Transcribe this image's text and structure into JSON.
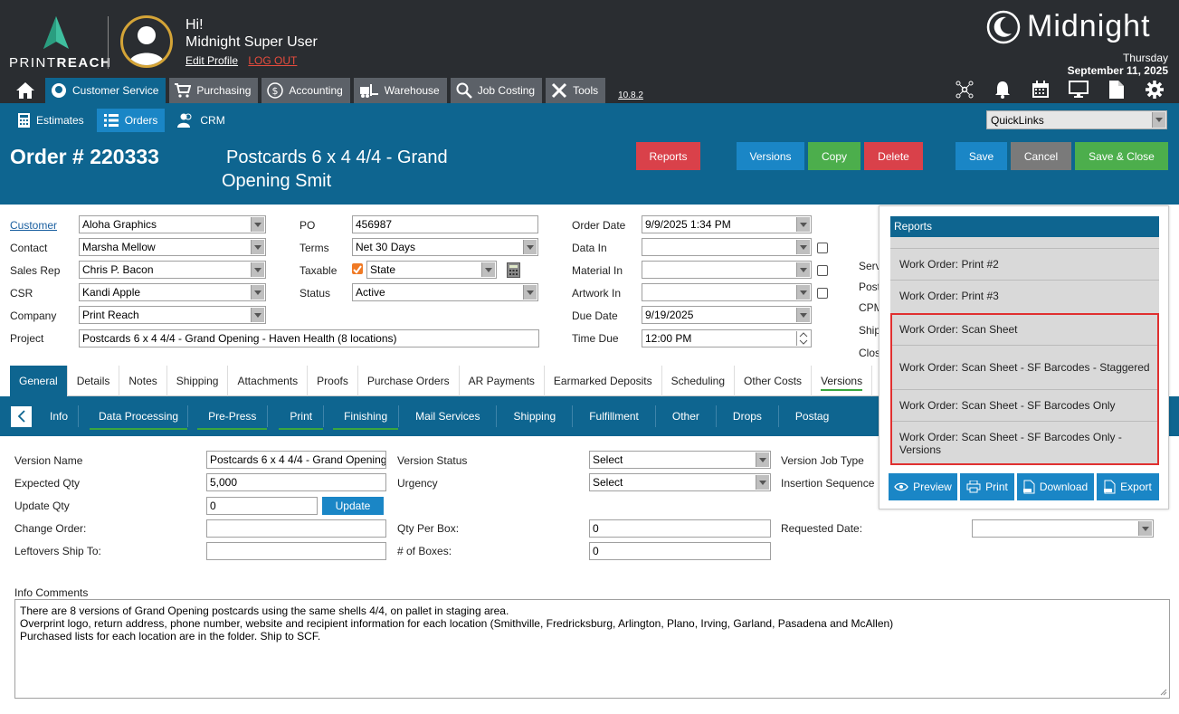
{
  "header": {
    "logo_text_a": "PRINT",
    "logo_text_b": "REACH",
    "greeting": "Hi!",
    "user_name": "Midnight Super User",
    "edit_profile": "Edit Profile",
    "logout": "LOG OUT",
    "brand": "Midnight",
    "date_day": "Thursday",
    "date_full": "September 11, 2025"
  },
  "main_nav": {
    "items": [
      "Customer Service",
      "Purchasing",
      "Accounting",
      "Warehouse",
      "Job Costing",
      "Tools"
    ],
    "version": "10.8.2"
  },
  "sub_nav": {
    "items": [
      "Estimates",
      "Orders",
      "CRM"
    ],
    "quicklinks": "QuickLinks"
  },
  "order": {
    "number": "Order # 220333",
    "title": "Postcards 6 x 4 4/4 - Grand Opening Smit"
  },
  "actions": {
    "reports": "Reports",
    "versions": "Versions",
    "copy": "Copy",
    "delete": "Delete",
    "save": "Save",
    "cancel": "Cancel",
    "save_close": "Save & Close"
  },
  "form": {
    "customer_label": "Customer",
    "customer": "Aloha Graphics",
    "contact_label": "Contact",
    "contact": "Marsha Mellow",
    "salesrep_label": "Sales Rep",
    "salesrep": "Chris P. Bacon",
    "csr_label": "CSR",
    "csr": "Kandi Apple",
    "company_label": "Company",
    "company": "Print Reach",
    "project_label": "Project",
    "project": "Postcards 6 x 4 4/4 - Grand Opening - Haven Health (8 locations)",
    "po_label": "PO",
    "po": "456987",
    "terms_label": "Terms",
    "terms": "Net 30 Days",
    "taxable_label": "Taxable",
    "taxable": "State",
    "status_label": "Status",
    "status": "Active",
    "orderdate_label": "Order Date",
    "orderdate": "9/9/2025 1:34 PM",
    "datain_label": "Data In",
    "materialin_label": "Material In",
    "artworkin_label": "Artwork In",
    "duedate_label": "Due Date",
    "duedate": "9/19/2025",
    "timedue_label": "Time Due",
    "timedue": "12:00 PM",
    "cut_labels": [
      "Serv",
      "Post",
      "CPM",
      "Ship",
      "Clos"
    ]
  },
  "tabs": [
    "General",
    "Details",
    "Notes",
    "Shipping",
    "Attachments",
    "Proofs",
    "Purchase Orders",
    "AR Payments",
    "Earmarked Deposits",
    "Scheduling",
    "Other Costs",
    "Versions"
  ],
  "subtabs": [
    "Info",
    "Data Processing",
    "Pre-Press",
    "Print",
    "Finishing",
    "Mail Services",
    "Shipping",
    "Fulfillment",
    "Other",
    "Drops",
    "Postag"
  ],
  "version": {
    "name_label": "Version Name",
    "name": "Postcards 6 x 4 4/4 - Grand Opening",
    "expqty_label": "Expected Qty",
    "expqty": "5,000",
    "updqty_label": "Update Qty",
    "updqty": "0",
    "update_btn": "Update",
    "changeorder_label": "Change Order:",
    "leftovers_label": "Leftovers Ship To:",
    "vstatus_label": "Version Status",
    "vstatus": "Select",
    "urgency_label": "Urgency",
    "urgency": "Select",
    "qtyperbox_label": "Qty Per Box:",
    "qtyperbox": "0",
    "boxes_label": "# of Boxes:",
    "boxes": "0",
    "jobtype_label": "Version Job Type",
    "insertion_label": "Insertion Sequence",
    "reqdate_label": "Requested Date:",
    "comments_label": "Info Comments",
    "comments": [
      "There are 8 versions of Grand Opening postcards using the same shells 4/4, on pallet in staging area.",
      "Overprint logo, return address, phone number, website and recipient information for each location (Smithville, Fredricksburg, Arlington, Plano, Irving, Garland, Pasadena and McAllen)",
      "Purchased lists for each location are in the folder. Ship to SCF."
    ]
  },
  "reports_panel": {
    "title": "Reports",
    "items": [
      "Work Order: Print #2",
      "Work Order: Print #3",
      "Work Order: Scan Sheet",
      "Work Order: Scan Sheet - SF Barcodes - Staggered",
      "Work Order: Scan Sheet - SF Barcodes Only",
      "Work Order: Scan Sheet - SF Barcodes Only - Versions"
    ],
    "preview": "Preview",
    "print": "Print",
    "download": "Download",
    "export": "Export"
  },
  "colors": {
    "dark_header": "#2a2d31",
    "primary_blue": "#0e6590",
    "button_blue": "#1a86c6",
    "red": "#d9414a",
    "green": "#4cae4c",
    "gray": "#7a7a7a"
  }
}
